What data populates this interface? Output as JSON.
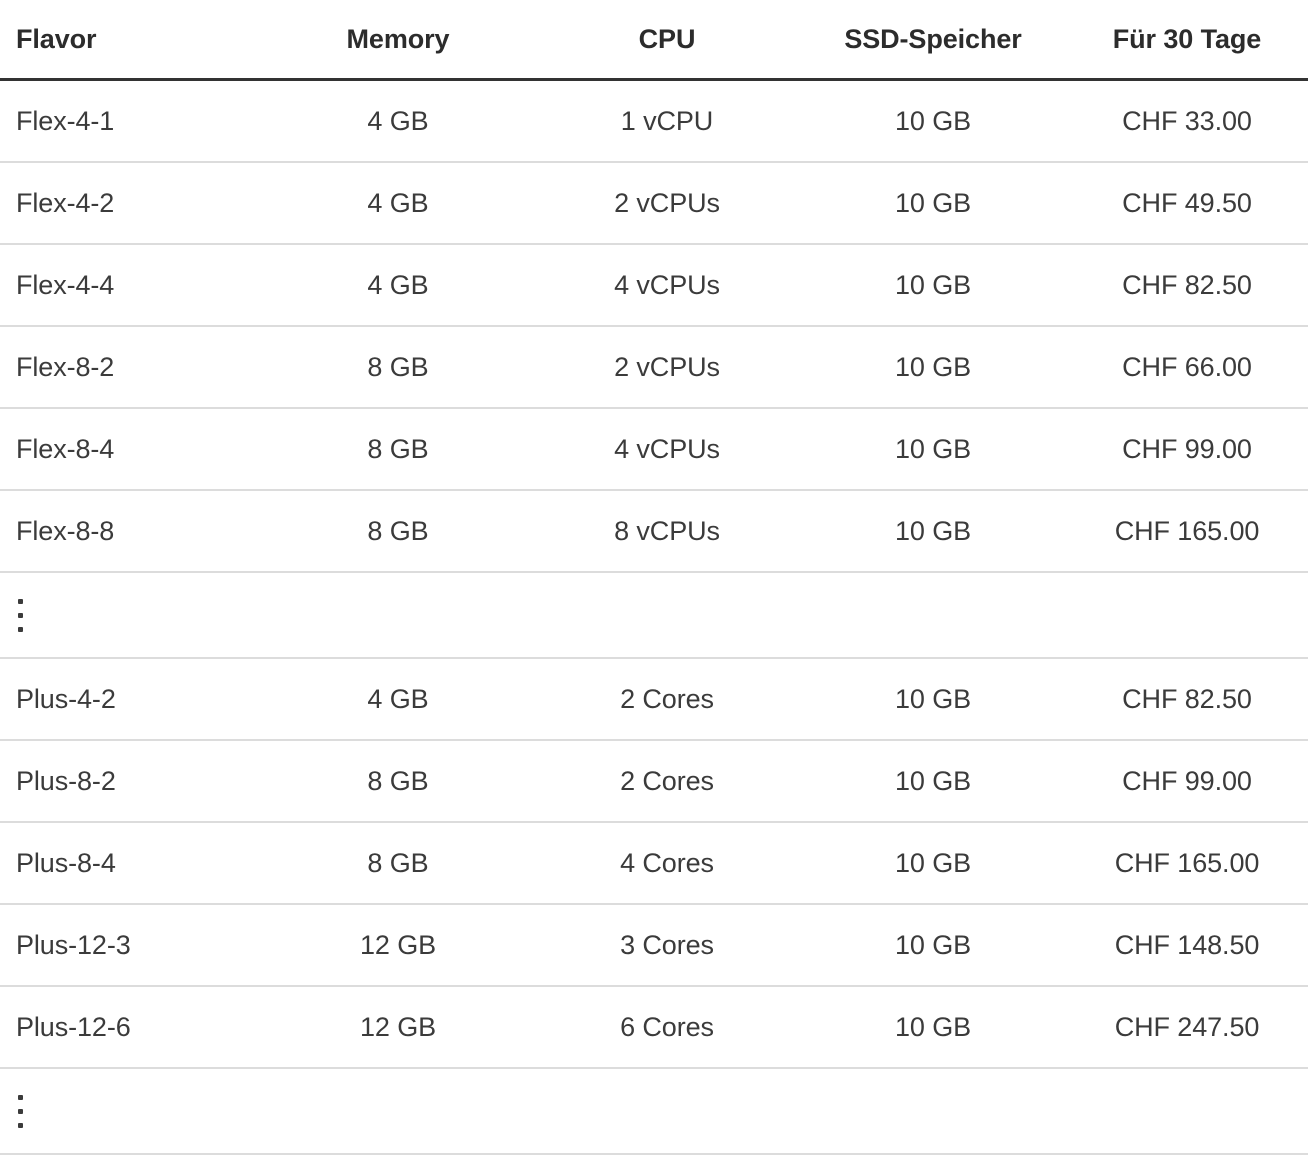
{
  "table": {
    "columns": [
      {
        "key": "flavor",
        "label": "Flavor",
        "align": "left"
      },
      {
        "key": "memory",
        "label": "Memory",
        "align": "center"
      },
      {
        "key": "cpu",
        "label": "CPU",
        "align": "center"
      },
      {
        "key": "ssd",
        "label": "SSD-Speicher",
        "align": "center"
      },
      {
        "key": "price",
        "label": "Für 30 Tage",
        "align": "center"
      }
    ],
    "header": {
      "flavor": "Flavor",
      "memory": "Memory",
      "cpu": "CPU",
      "ssd": "SSD-Speicher",
      "price": "Für 30 Tage"
    },
    "rows": [
      {
        "type": "data",
        "flavor": "Flex-4-1",
        "memory": "4 GB",
        "cpu": "1 vCPU",
        "ssd": "10 GB",
        "price": "CHF 33.00"
      },
      {
        "type": "data",
        "flavor": "Flex-4-2",
        "memory": "4 GB",
        "cpu": "2 vCPUs",
        "ssd": "10 GB",
        "price": "CHF 49.50"
      },
      {
        "type": "data",
        "flavor": "Flex-4-4",
        "memory": "4 GB",
        "cpu": "4 vCPUs",
        "ssd": "10 GB",
        "price": "CHF 82.50"
      },
      {
        "type": "data",
        "flavor": "Flex-8-2",
        "memory": "8 GB",
        "cpu": "2 vCPUs",
        "ssd": "10 GB",
        "price": "CHF 66.00"
      },
      {
        "type": "data",
        "flavor": "Flex-8-4",
        "memory": "8 GB",
        "cpu": "4 vCPUs",
        "ssd": "10 GB",
        "price": "CHF 99.00"
      },
      {
        "type": "data",
        "flavor": "Flex-8-8",
        "memory": "8 GB",
        "cpu": "8 vCPUs",
        "ssd": "10 GB",
        "price": "CHF 165.00"
      },
      {
        "type": "ellipsis",
        "flavor": "⋮",
        "memory": "",
        "cpu": "",
        "ssd": "",
        "price": ""
      },
      {
        "type": "data",
        "flavor": "Plus-4-2",
        "memory": "4 GB",
        "cpu": "2 Cores",
        "ssd": "10 GB",
        "price": "CHF 82.50"
      },
      {
        "type": "data",
        "flavor": "Plus-8-2",
        "memory": "8 GB",
        "cpu": "2 Cores",
        "ssd": "10 GB",
        "price": "CHF 99.00"
      },
      {
        "type": "data",
        "flavor": "Plus-8-4",
        "memory": "8 GB",
        "cpu": "4 Cores",
        "ssd": "10 GB",
        "price": "CHF 165.00"
      },
      {
        "type": "data",
        "flavor": "Plus-12-3",
        "memory": "12 GB",
        "cpu": "3 Cores",
        "ssd": "10 GB",
        "price": "CHF 148.50"
      },
      {
        "type": "data",
        "flavor": "Plus-12-6",
        "memory": "12 GB",
        "cpu": "6 Cores",
        "ssd": "10 GB",
        "price": "CHF 247.50"
      },
      {
        "type": "ellipsis",
        "flavor": "⋮",
        "memory": "",
        "cpu": "",
        "ssd": "",
        "price": ""
      }
    ]
  },
  "colors": {
    "background": "#ffffff",
    "header_text": "#2c2c2c",
    "body_text": "#3b3b3b",
    "header_rule": "#333333",
    "row_rule": "#dcdcdc"
  }
}
